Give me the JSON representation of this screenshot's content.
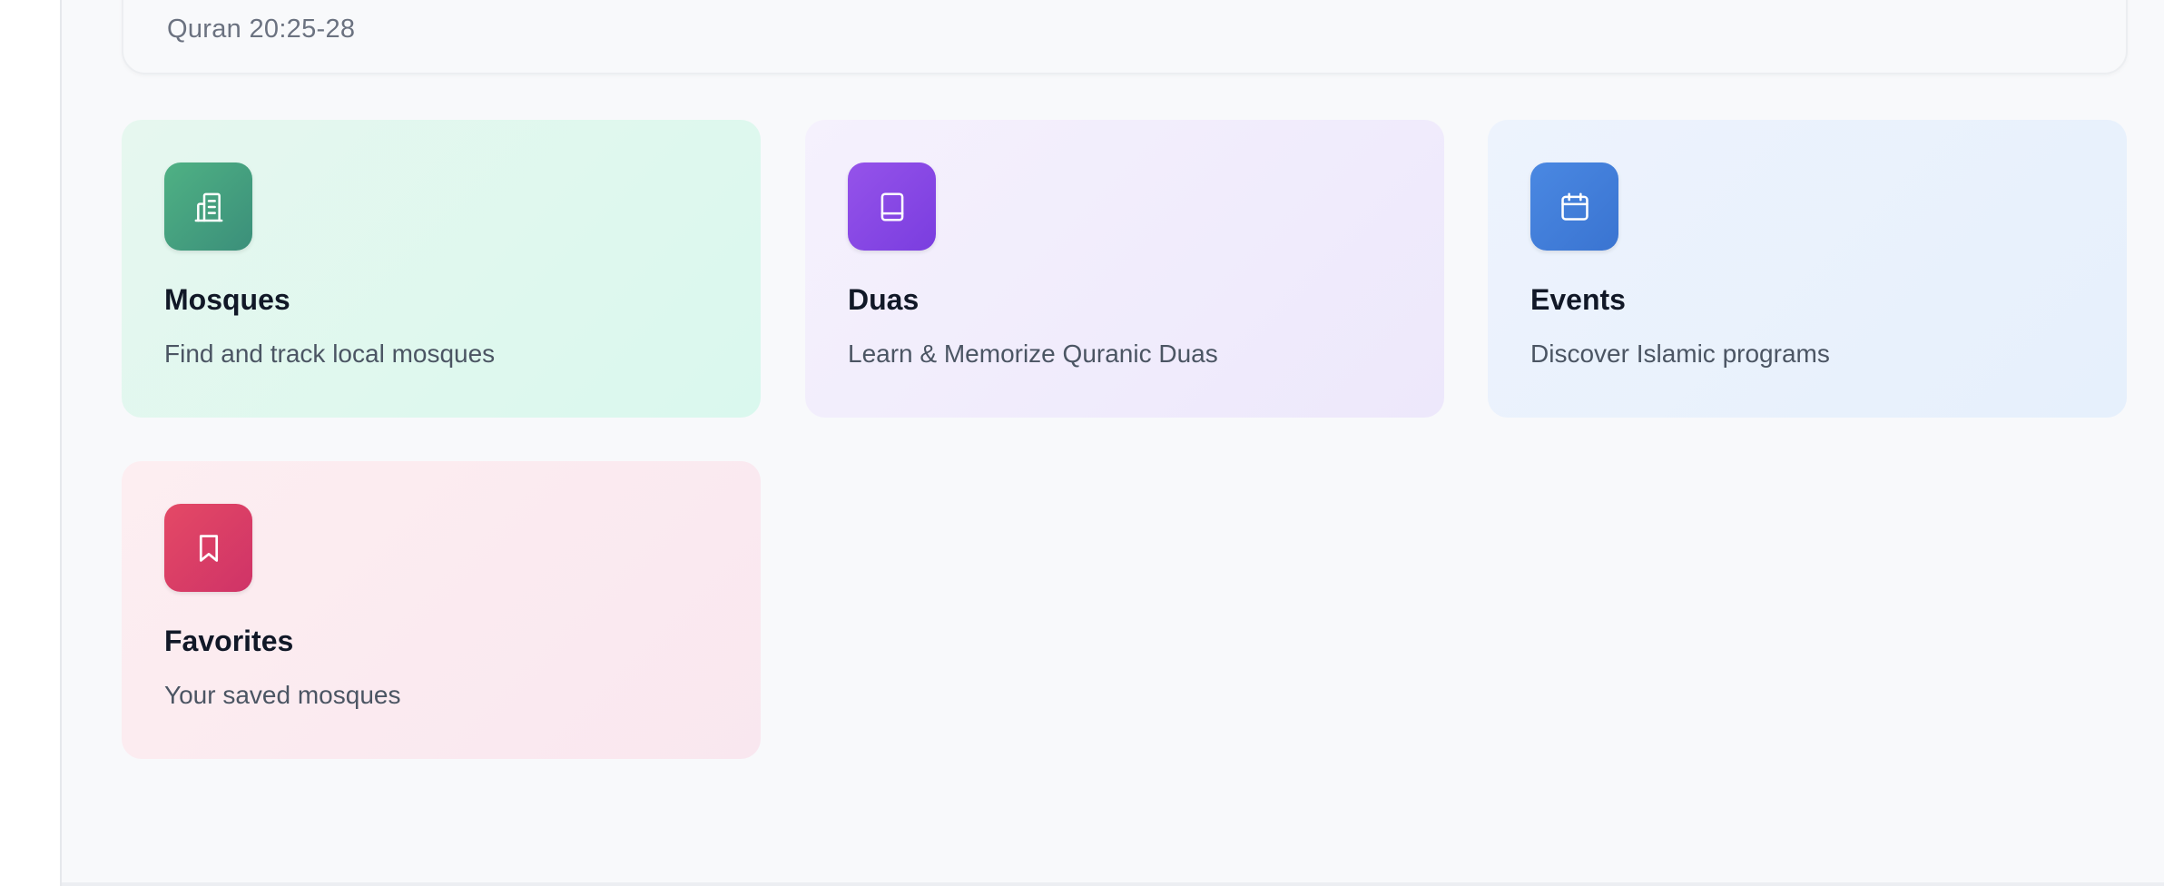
{
  "verse": {
    "reference": "Quran 20:25-28"
  },
  "tiles": [
    {
      "title": "Mosques",
      "description": "Find and track local mosques",
      "icon": "mosque-building-icon",
      "accent": "#3f9d7e"
    },
    {
      "title": "Duas",
      "description": "Learn & Memorize Quranic Duas",
      "icon": "book-icon",
      "accent": "#8447e6"
    },
    {
      "title": "Events",
      "description": "Discover Islamic programs",
      "icon": "calendar-icon",
      "accent": "#3f7ed9"
    },
    {
      "title": "Favorites",
      "description": "Your saved mosques",
      "icon": "bookmark-icon",
      "accent": "#d93b66"
    }
  ]
}
